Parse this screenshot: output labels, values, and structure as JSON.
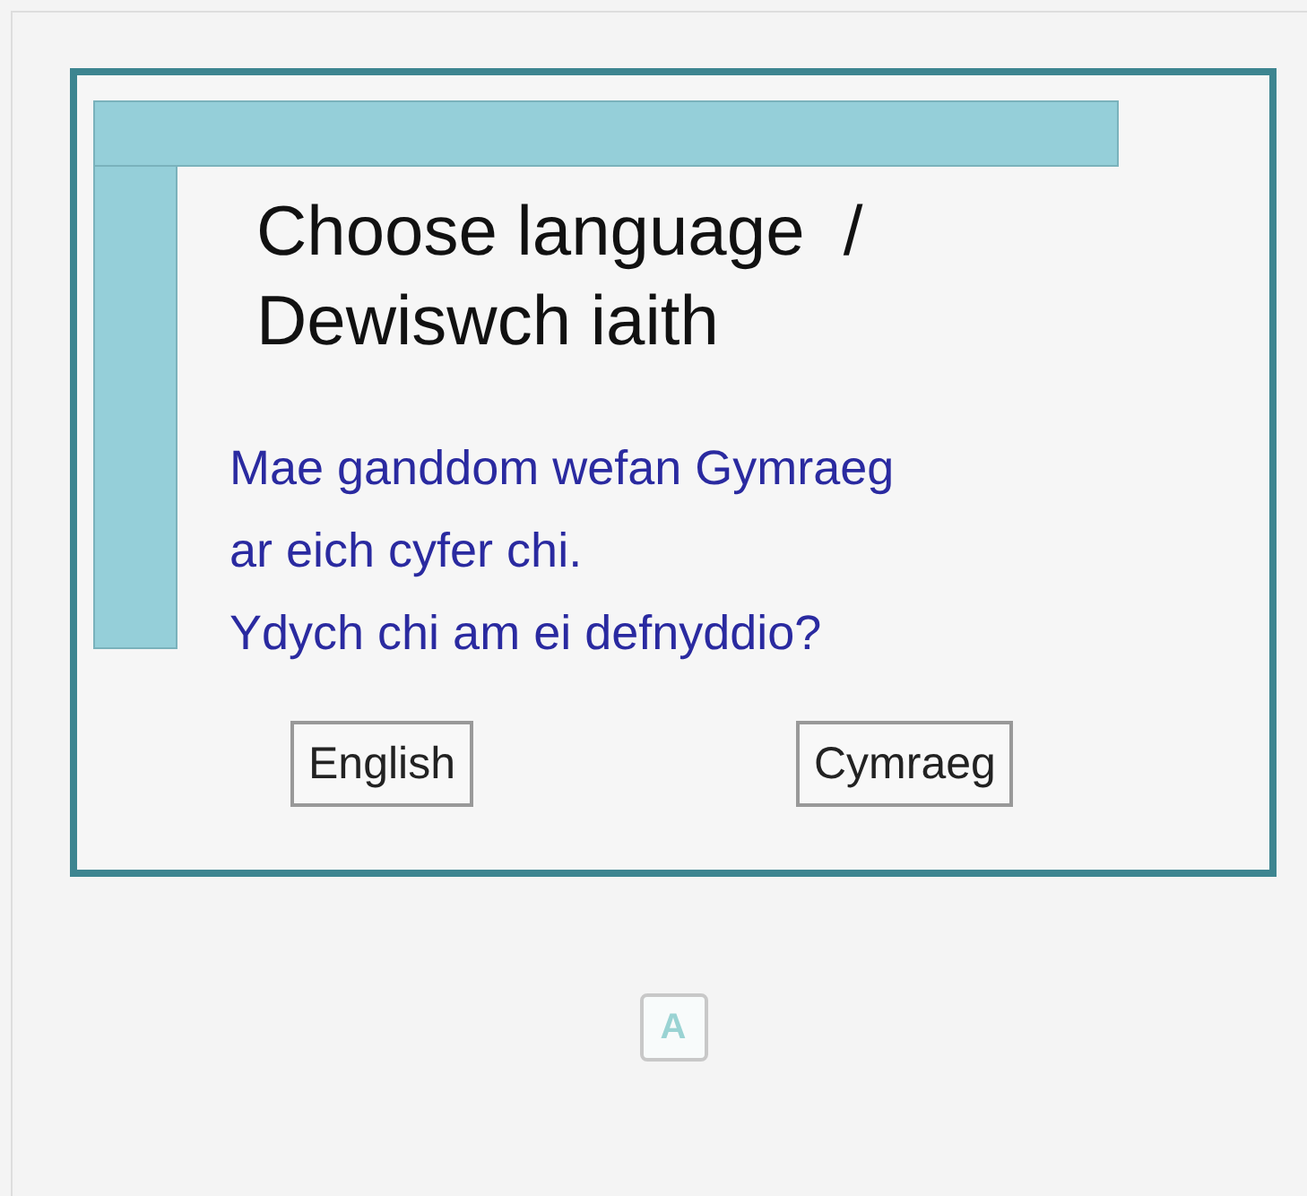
{
  "dialog": {
    "title_lines": [
      "Choose language  /",
      "Dewiswch iaith"
    ],
    "message_lines": [
      "Mae ganddom wefan Gymraeg",
      "ar eich cyfer chi.",
      "Ydych chi am ei defnyddio?"
    ],
    "buttons": [
      "English",
      "Cymraeg"
    ]
  },
  "footer": {
    "badge": "A"
  }
}
